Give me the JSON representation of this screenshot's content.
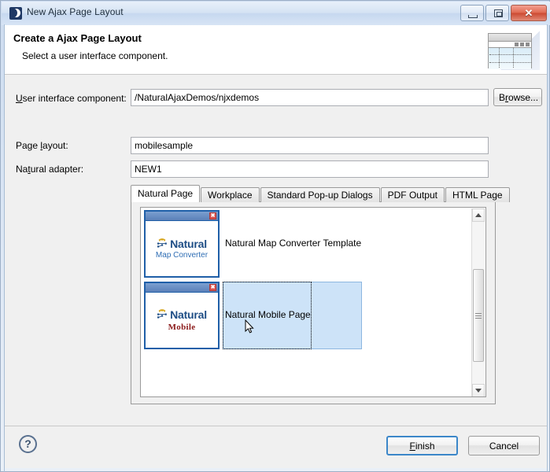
{
  "window": {
    "title": "New Ajax Page Layout",
    "icon": "natural-app-icon",
    "controls": {
      "minimize": "minimize-button",
      "maximize": "maximize-button",
      "close_glyph": "✕"
    }
  },
  "header": {
    "title": "Create a Ajax Page Layout",
    "subtitle": "Select a user interface component.",
    "banner_icon": "wizard-page-layout-banner"
  },
  "form": {
    "fields": [
      {
        "label_pre": "U",
        "label_post": "ser interface component:",
        "value": "/NaturalAjaxDemos/njxdemos",
        "name": "user-interface-component"
      },
      {
        "label_pre": "Page l",
        "label_post": "ayout:",
        "mnemonic_index": 5,
        "value": "mobilesample",
        "name": "page-layout"
      },
      {
        "label_pre": "Nat",
        "label_post": "ural adapter:",
        "value": "NEW1",
        "name": "natural-adapter"
      }
    ],
    "browse_pre": "B",
    "browse_mn": "r",
    "browse_post": "owse..."
  },
  "tabs": [
    {
      "label": "Natural Page",
      "active": true
    },
    {
      "label": "Workplace",
      "active": false
    },
    {
      "label": "Standard Pop-up Dialogs",
      "active": false
    },
    {
      "label": "PDF Output",
      "active": false
    },
    {
      "label": "HTML Page",
      "active": false
    }
  ],
  "templates": [
    {
      "label": "Natural Map Converter Template",
      "logo_word": "Natural",
      "logo_sub": "Map Converter",
      "selected": false,
      "close_glyph": "✖"
    },
    {
      "label": "Natural Mobile Page",
      "logo_word": "Natural",
      "logo_sub": "Mobile",
      "selected": true,
      "close_glyph": "✖"
    }
  ],
  "scrollbar": {
    "up_icon": "scroll-up-arrow",
    "down_icon": "scroll-down-arrow",
    "thumb": "scroll-thumb"
  },
  "footer": {
    "help_glyph": "?",
    "finish_pre": "",
    "finish_mn": "F",
    "finish_post": "inish",
    "cancel_label": "Cancel"
  },
  "colors": {
    "accent": "#3c87c9",
    "selection": "#cde3f8",
    "logo_blue": "#1f4e86",
    "logo_sub_blue": "#2e6db4",
    "mobile_red": "#8b1a1a",
    "thumb_border": "#1f5fa8",
    "close_red": "#d9534f"
  }
}
